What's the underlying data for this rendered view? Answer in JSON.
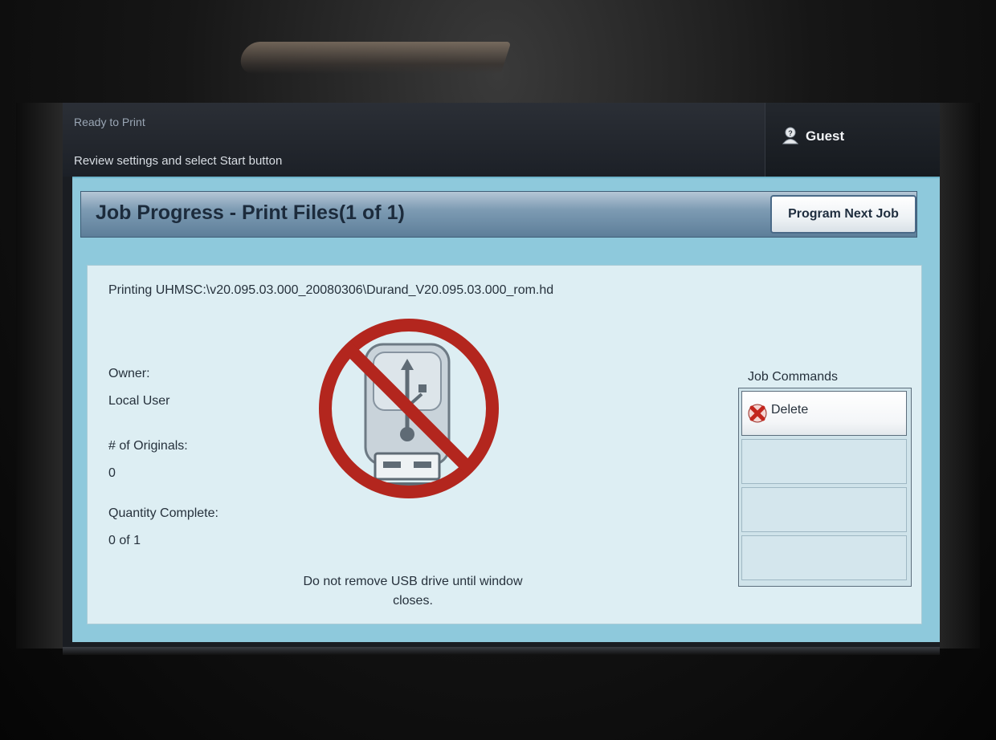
{
  "status_bar": {
    "title": "Ready to Print",
    "subtitle": "Review settings and select Start button",
    "user_name": "Guest"
  },
  "job_window": {
    "title": "Job Progress - Print Files(1 of 1)",
    "program_next_job_label": "Program Next Job",
    "file_line": "Printing UHMSC:\\v20.095.03.000_20080306\\Durand_V20.095.03.000_rom.hd",
    "owner_label": "Owner:",
    "owner_value": "Local User",
    "originals_label": "# of Originals:",
    "originals_value": "0",
    "quantity_label": "Quantity Complete:",
    "quantity_value": "0 of 1",
    "usb_warning": "Do not remove USB drive until window closes."
  },
  "job_commands": {
    "label": "Job Commands",
    "delete_label": "Delete"
  },
  "icons": {
    "user": "user-help-icon",
    "usb_prohibited": "no-usb-removal-icon",
    "delete": "red-x-icon"
  },
  "colors": {
    "prohibition_red": "#b3261e",
    "header_blue": "#5d7e99",
    "panel_background": "#ddeef3",
    "frame_cyan": "#8ec9dc"
  }
}
